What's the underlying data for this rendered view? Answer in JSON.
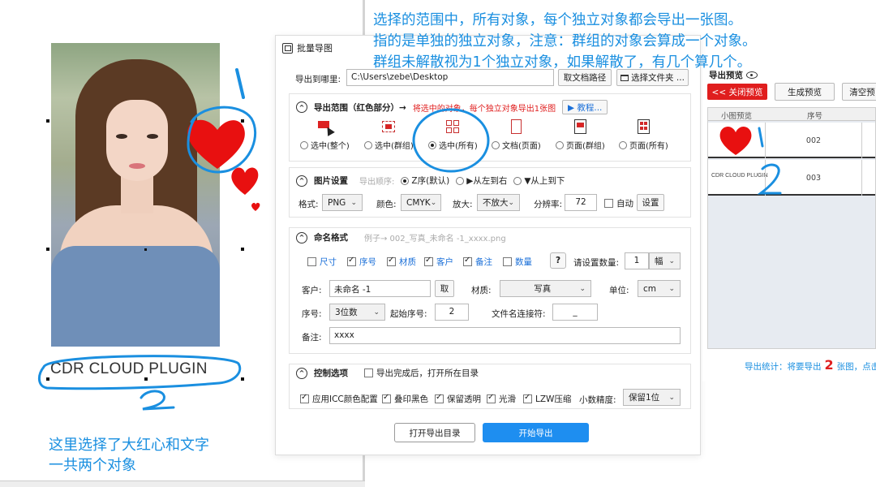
{
  "annotations": {
    "top_lines": [
      "选择的范围中，所有对象，每个独立对象都会导出一张图。",
      "指的是单独的独立对象，注意：群组的对象会算成一个对象。",
      "群组未解散视为1个独立对象，如果解散了，有几个算几个。"
    ],
    "caption_lines": [
      "这里选择了大红心和文字",
      "一共两个对象"
    ],
    "num_one": "1",
    "num_two": "2",
    "preview_num_one": "1",
    "preview_num_two": "2",
    "color": "#1a8fe0"
  },
  "canvas": {
    "text": "CDR CLOUD PLUGIN",
    "heart_color": "#e81010"
  },
  "dialog": {
    "title": "批量导图",
    "export_to_label": "导出到哪里:",
    "export_path": "C:\\Users\\zebe\\Desktop",
    "get_doc_path": "取文档路径",
    "choose_folder": "选择文件夹 ...",
    "scope": {
      "title": "导出范围（红色部分）→",
      "hint": "将选中的对象，每个独立对象导出1张图",
      "tutorial": "▶ 教程...",
      "options": [
        {
          "label": "选中(整个)",
          "selected": false
        },
        {
          "label": "选中(群组)",
          "selected": false
        },
        {
          "label": "选中(所有)",
          "selected": true
        },
        {
          "label": "文档(页面)",
          "selected": false
        },
        {
          "label": "页面(群组)",
          "selected": false
        },
        {
          "label": "页面(所有)",
          "selected": false
        }
      ]
    },
    "image_settings": {
      "title": "图片设置",
      "order_label": "导出顺序:",
      "orders": [
        {
          "label": "Z序(默认)",
          "selected": true
        },
        {
          "label": "▶从左到右",
          "selected": false
        },
        {
          "label": "▼从上到下",
          "selected": false
        }
      ],
      "format_label": "格式:",
      "format": "PNG",
      "color_label": "颜色:",
      "color": "CMYK",
      "zoom_label": "放大:",
      "zoom": "不放大",
      "dpi_label": "分辨率:",
      "dpi": "72",
      "auto_label": "自动",
      "settings_btn": "设置"
    },
    "naming": {
      "title": "命名格式",
      "example": "例子→ 002_写真_未命名 -1_xxxx.png",
      "checks": [
        {
          "label": "尺寸",
          "checked": false
        },
        {
          "label": "序号",
          "checked": true
        },
        {
          "label": "材质",
          "checked": true
        },
        {
          "label": "客户",
          "checked": true
        },
        {
          "label": "备注",
          "checked": true
        },
        {
          "label": "数量",
          "checked": false
        }
      ],
      "help": "?",
      "qty_label": "请设置数量:",
      "qty": "1",
      "qty_unit": "幅",
      "client_label": "客户:",
      "client": "未命名 -1",
      "take_btn": "取",
      "material_label": "材质:",
      "material": "写真",
      "unit_label": "单位:",
      "unit": "cm",
      "seq_label": "序号:",
      "seq": "3位数",
      "start_label": "起始序号:",
      "start": "2",
      "joiner_label": "文件名连接符:",
      "joiner": "_",
      "note_label": "备注:",
      "note": "xxxx"
    },
    "control": {
      "title": "控制选项",
      "open_after": "导出完成后，打开所在目录",
      "checks": [
        {
          "label": "应用ICC颜色配置",
          "checked": true
        },
        {
          "label": "叠印黑色",
          "checked": true
        },
        {
          "label": "保留透明",
          "checked": true
        },
        {
          "label": "光滑",
          "checked": true
        },
        {
          "label": "LZW压缩",
          "checked": true
        }
      ],
      "precision_label": "小数精度:",
      "precision": "保留1位"
    },
    "open_dir_btn": "打开导出目录",
    "start_btn": "开始导出"
  },
  "preview": {
    "title": "导出预览",
    "close_btn": "<< 关闭预览",
    "gen_btn": "生成预览",
    "clear_btn": "清空预",
    "col_thumb": "小图预览",
    "col_seq": "序号",
    "rows": [
      {
        "seq": "002",
        "thumb": "heart"
      },
      {
        "seq": "003",
        "thumb": "CDR CLOUD PLUGIN"
      }
    ],
    "stat_prefix": "导出统计：将要导出",
    "stat_count": "2",
    "stat_suffix": "张图，点击"
  }
}
